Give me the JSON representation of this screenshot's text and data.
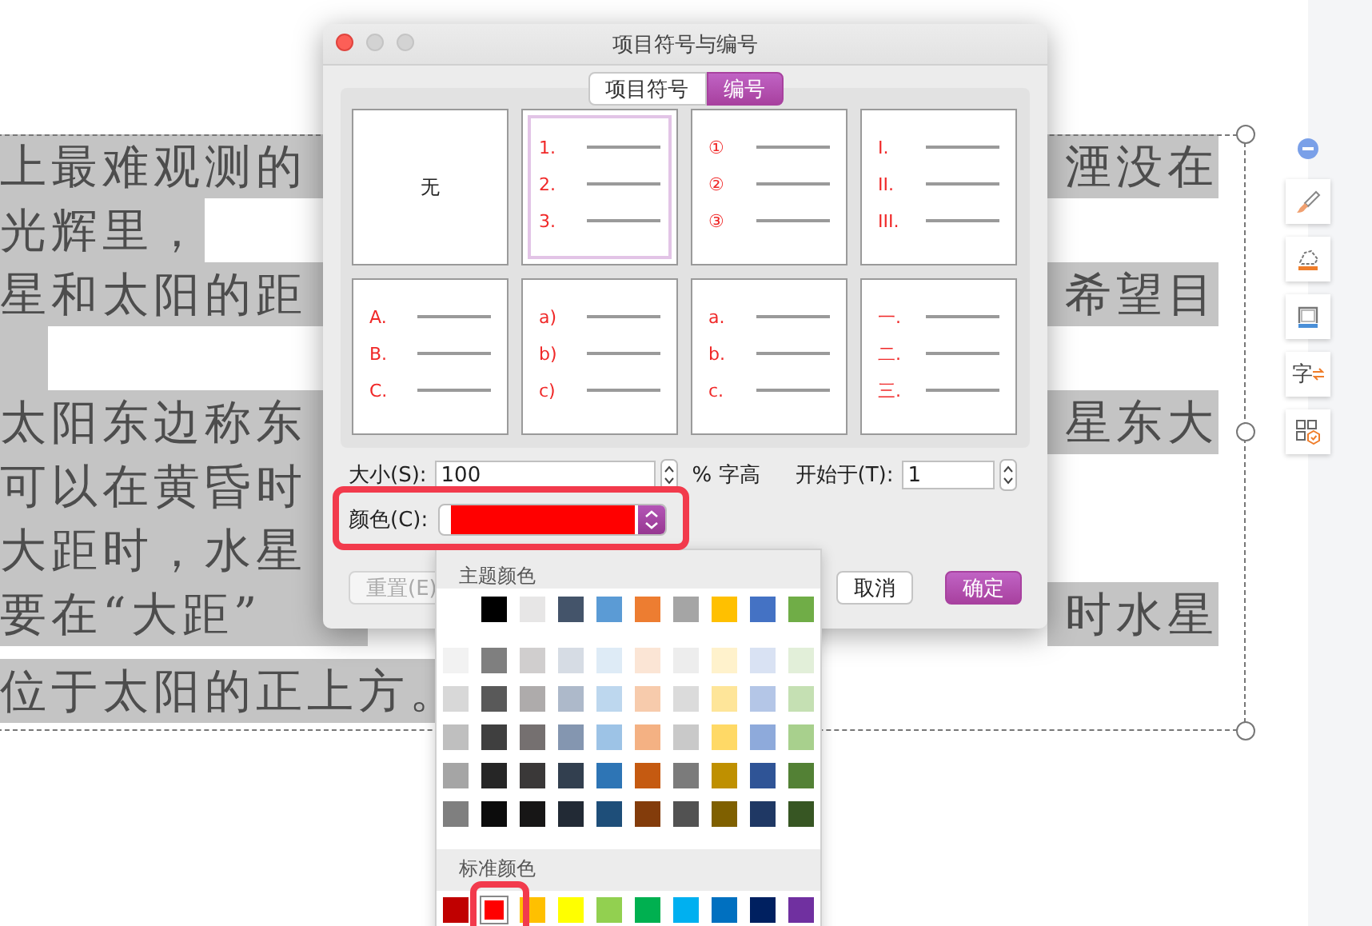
{
  "document": {
    "lines": [
      {
        "kind": "text",
        "left": "上最难观测的",
        "right": "湮没在",
        "left_fill": true
      },
      {
        "kind": "text",
        "left": "光辉里，",
        "left_fill": false
      },
      {
        "kind": "text",
        "left": "星和太阳的距",
        "right": "希望目",
        "left_fill": true
      },
      {
        "kind": "blank",
        "left_fill": false
      },
      {
        "kind": "text",
        "left": "太阳东边称东",
        "right": "星东大",
        "left_fill": true
      },
      {
        "kind": "text",
        "left": "可以在黄昏时",
        "left_fill": true
      },
      {
        "kind": "text",
        "left": "大距时，水星",
        "left_fill": true
      },
      {
        "kind": "text",
        "left": "要在“大距”",
        "right": "时水星",
        "left_fill": true
      },
      {
        "kind": "text",
        "left": "位于太阳的正上方。",
        "left_fill": false
      }
    ]
  },
  "side_toolbar": [
    {
      "kind": "collapse"
    },
    {
      "kind": "brush"
    },
    {
      "kind": "eraser"
    },
    {
      "kind": "frame"
    },
    {
      "kind": "text-convert",
      "glyph": "字"
    },
    {
      "kind": "apps"
    }
  ],
  "dialog": {
    "title": "项目符号与编号",
    "tabs": [
      {
        "label": "项目符号",
        "selected": false
      },
      {
        "label": "编号",
        "selected": true
      }
    ],
    "formats": [
      {
        "kind": "none",
        "label": "无",
        "selected": false
      },
      {
        "kind": "list",
        "markers": [
          "1.",
          "2.",
          "3."
        ],
        "selected": true
      },
      {
        "kind": "list",
        "markers": [
          "①",
          "②",
          "③"
        ],
        "selected": false
      },
      {
        "kind": "list",
        "markers": [
          "I.",
          "II.",
          "III."
        ],
        "selected": false
      },
      {
        "kind": "list",
        "markers": [
          "A.",
          "B.",
          "C."
        ],
        "selected": false
      },
      {
        "kind": "list",
        "markers": [
          "a)",
          "b)",
          "c)"
        ],
        "selected": false
      },
      {
        "kind": "list",
        "markers": [
          "a.",
          "b.",
          "c."
        ],
        "selected": false
      },
      {
        "kind": "list",
        "markers": [
          "一.",
          "二.",
          "三."
        ],
        "selected": false
      }
    ],
    "size": {
      "label": "大小(S):",
      "value": "100",
      "unit": "% 字高"
    },
    "start": {
      "label": "开始于(T):",
      "value": "1"
    },
    "color": {
      "label": "颜色(C):",
      "color": "#ff0000",
      "highlighted": true
    },
    "buttons": [
      {
        "label": "重置(E)",
        "kind": "default",
        "disabled": true
      },
      {
        "label": "取消",
        "kind": "default",
        "disabled": false
      },
      {
        "label": "确定",
        "kind": "primary",
        "disabled": false
      }
    ]
  },
  "color_menu": {
    "theme_title": "主题颜色",
    "theme": [
      {
        "color": "#000000"
      },
      {
        "color": "#e7e6e6"
      },
      {
        "color": "#44546a"
      },
      {
        "color": "#5b9bd5"
      },
      {
        "color": "#ed7d31"
      },
      {
        "color": "#a5a5a5"
      },
      {
        "color": "#ffc000"
      },
      {
        "color": "#4472c4"
      },
      {
        "color": "#70ad47"
      }
    ],
    "shades": [
      {
        "swatches": [
          {
            "color": "#f2f2f2"
          },
          {
            "color": "#7f7f7f"
          },
          {
            "color": "#d0cece"
          },
          {
            "color": "#d6dce4"
          },
          {
            "color": "#deebf6"
          },
          {
            "color": "#fbe5d5"
          },
          {
            "color": "#ededed"
          },
          {
            "color": "#fff2cc"
          },
          {
            "color": "#d9e2f3"
          },
          {
            "color": "#e2efd9"
          }
        ]
      },
      {
        "swatches": [
          {
            "color": "#d8d8d8"
          },
          {
            "color": "#595959"
          },
          {
            "color": "#aeabab"
          },
          {
            "color": "#adb9ca"
          },
          {
            "color": "#bdd7ee"
          },
          {
            "color": "#f7cbac"
          },
          {
            "color": "#dbdbdb"
          },
          {
            "color": "#fee599"
          },
          {
            "color": "#b4c6e7"
          },
          {
            "color": "#c5e0b3"
          }
        ]
      },
      {
        "swatches": [
          {
            "color": "#bfbfbf"
          },
          {
            "color": "#3f3f3f"
          },
          {
            "color": "#757070"
          },
          {
            "color": "#8496b0"
          },
          {
            "color": "#9dc3e6"
          },
          {
            "color": "#f4b183"
          },
          {
            "color": "#c9c9c9"
          },
          {
            "color": "#ffd966"
          },
          {
            "color": "#8eaadb"
          },
          {
            "color": "#a8d08d"
          }
        ]
      },
      {
        "swatches": [
          {
            "color": "#a5a5a5"
          },
          {
            "color": "#262626"
          },
          {
            "color": "#3a3838"
          },
          {
            "color": "#323f4f"
          },
          {
            "color": "#2e75b5"
          },
          {
            "color": "#c55a11"
          },
          {
            "color": "#7b7b7b"
          },
          {
            "color": "#bf9000"
          },
          {
            "color": "#2f5496"
          },
          {
            "color": "#538135"
          }
        ]
      },
      {
        "swatches": [
          {
            "color": "#7f7f7f"
          },
          {
            "color": "#0c0c0c"
          },
          {
            "color": "#171616"
          },
          {
            "color": "#222a35"
          },
          {
            "color": "#1e4e79"
          },
          {
            "color": "#833c0b"
          },
          {
            "color": "#525252"
          },
          {
            "color": "#7f6000"
          },
          {
            "color": "#1f3864"
          },
          {
            "color": "#375623"
          }
        ]
      }
    ],
    "standard_title": "标准颜色",
    "standard": [
      {
        "color": "#c00000",
        "selected": false,
        "highlighted": false
      },
      {
        "color": "#ff0000",
        "selected": true,
        "highlighted": true
      },
      {
        "color": "#ffc000",
        "selected": false,
        "highlighted": false
      },
      {
        "color": "#ffff00",
        "selected": false,
        "highlighted": false
      },
      {
        "color": "#92d050",
        "selected": false,
        "highlighted": false
      },
      {
        "color": "#00b050",
        "selected": false,
        "highlighted": false
      },
      {
        "color": "#00b0f0",
        "selected": false,
        "highlighted": false
      },
      {
        "color": "#0070c0",
        "selected": false,
        "highlighted": false
      },
      {
        "color": "#002060",
        "selected": false,
        "highlighted": false
      },
      {
        "color": "#7030a0",
        "selected": false,
        "highlighted": false
      }
    ]
  }
}
